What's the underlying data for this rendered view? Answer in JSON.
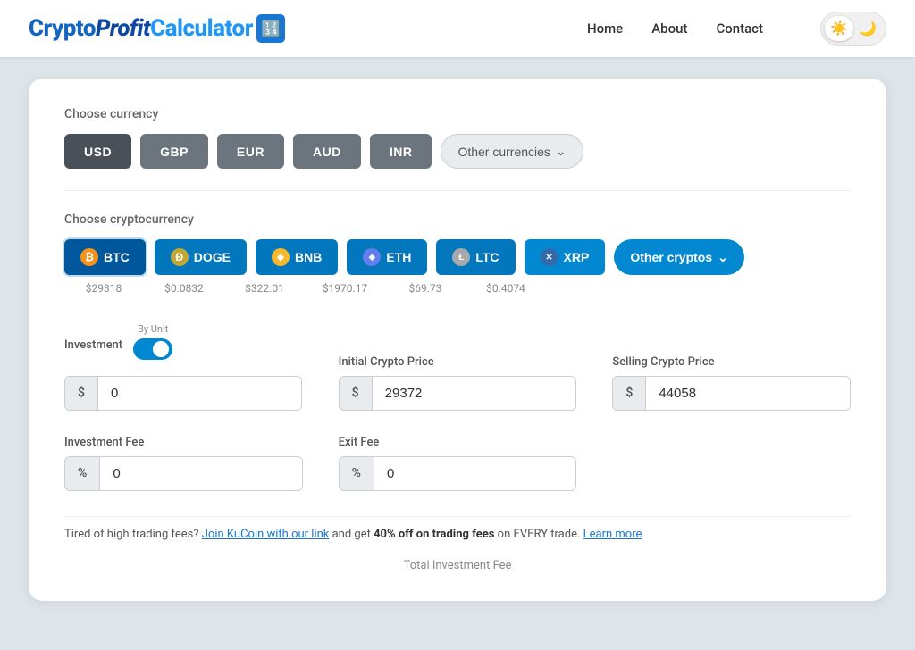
{
  "nav": {
    "logo_crypto": "Crypto",
    "logo_profit": "Profit",
    "logo_calculator": "Calculator",
    "logo_icon": "▦",
    "links": [
      {
        "label": "Home",
        "name": "home"
      },
      {
        "label": "About",
        "name": "about"
      },
      {
        "label": "Contact",
        "name": "contact"
      }
    ],
    "theme_sun": "☀",
    "theme_moon": "🌙"
  },
  "currency": {
    "section_label": "Choose currency",
    "buttons": [
      "USD",
      "GBP",
      "EUR",
      "AUD",
      "INR"
    ],
    "other_label": "Other currencies",
    "active": "USD"
  },
  "crypto": {
    "section_label": "Choose cryptocurrency",
    "coins": [
      {
        "id": "btc",
        "label": "BTC",
        "icon": "₿",
        "icon_class": "btc-icon",
        "price": "$29318"
      },
      {
        "id": "doge",
        "label": "DOGE",
        "icon": "Ð",
        "icon_class": "doge-icon",
        "price": "$0.0832"
      },
      {
        "id": "bnb",
        "label": "BNB",
        "icon": "◆",
        "icon_class": "bnb-icon",
        "price": "$322.01"
      },
      {
        "id": "eth",
        "label": "ETH",
        "icon": "⬥",
        "icon_class": "eth-icon",
        "price": "$1970.17"
      },
      {
        "id": "ltc",
        "label": "LTC",
        "icon": "Ł",
        "icon_class": "ltc-icon",
        "price": "$69.73"
      },
      {
        "id": "xrp",
        "label": "XRP",
        "icon": "✕",
        "icon_class": "xrp-icon",
        "price": "$0.4074"
      }
    ],
    "other_label": "Other cryptos",
    "active": "btc"
  },
  "form": {
    "by_unit_label": "By Unit",
    "investment_label": "Investment",
    "investment_prefix": "$",
    "investment_value": "0",
    "initial_price_label": "Initial Crypto Price",
    "initial_price_prefix": "$",
    "initial_price_value": "29372",
    "selling_price_label": "Selling Crypto Price",
    "selling_price_prefix": "$",
    "selling_price_value": "44058",
    "inv_fee_label": "Investment Fee",
    "inv_fee_prefix": "%",
    "inv_fee_value": "0",
    "exit_fee_label": "Exit Fee",
    "exit_fee_prefix": "%",
    "exit_fee_value": "0"
  },
  "promo": {
    "text_before": "Tired of high trading fees? ",
    "link1_label": "Join KuCoin with our link",
    "text_middle": " and get ",
    "bold_text": "40% off on trading fees",
    "text_after": " on EVERY trade. ",
    "link2_label": "Learn more"
  },
  "footer": {
    "total_label": "Total Investment Fee"
  }
}
